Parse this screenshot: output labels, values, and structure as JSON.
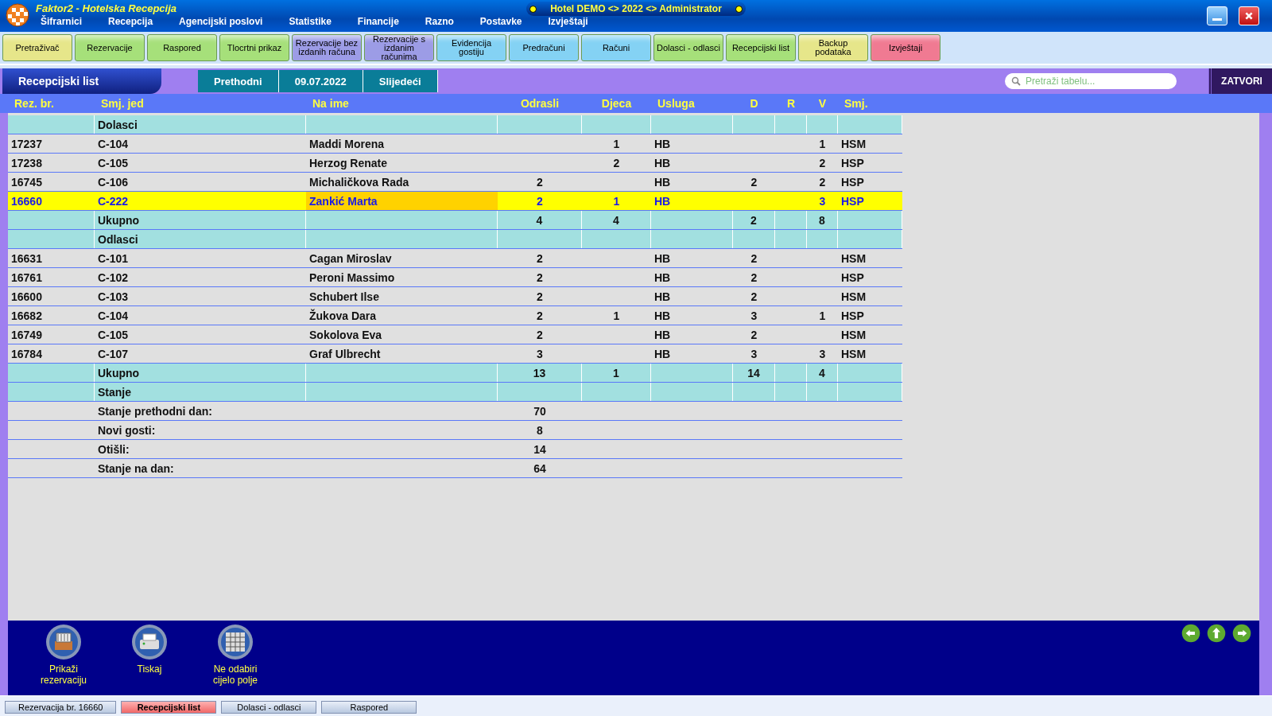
{
  "window": {
    "title": "Faktor2 - Hotelska Recepcija",
    "banner": "Hotel DEMO <> 2022 <> Administrator"
  },
  "menu": [
    "Šifrarnici",
    "Recepcija",
    "Agencijski poslovi",
    "Statistike",
    "Financije",
    "Razno",
    "Postavke",
    "Izvještaji"
  ],
  "toolbar": [
    {
      "label": "Pretraživač",
      "color": "#e6e68a"
    },
    {
      "label": "Rezervacije",
      "color": "#a6e07a"
    },
    {
      "label": "Raspored",
      "color": "#a6e07a"
    },
    {
      "label": "Tlocrtni prikaz",
      "color": "#a6e07a"
    },
    {
      "label": "Rezervacije bez izdanih računa",
      "color": "#9c9ce6"
    },
    {
      "label": "Rezervacije s izdanim računima",
      "color": "#9c9ce6"
    },
    {
      "label": "Evidencija gostiju",
      "color": "#84d2f4"
    },
    {
      "label": "Predračuni",
      "color": "#84d2f4"
    },
    {
      "label": "Računi",
      "color": "#84d2f4"
    },
    {
      "label": "Dolasci - odlasci",
      "color": "#a6e07a"
    },
    {
      "label": "Recepcijski list",
      "color": "#a6e07a"
    },
    {
      "label": "Backup podataka",
      "color": "#e6e68a"
    },
    {
      "label": "Izvještaji",
      "color": "#f07a92"
    }
  ],
  "panel": {
    "title": "Recepcijski list",
    "prev": "Prethodni",
    "date": "09.07.2022",
    "next": "Slijedeći",
    "search": {
      "placeholder": "Pretraži tabelu..."
    },
    "close": "ZATVORI"
  },
  "table": {
    "columns": [
      "Rez. br.",
      "Smj. jed",
      "Na ime",
      "Odrasli",
      "Djeca",
      "Usluga",
      "D",
      "R",
      "V",
      "Smj."
    ],
    "rows": [
      {
        "kind": "group",
        "label": "Dolasci"
      },
      {
        "kind": "guest",
        "selected": false,
        "rez": "17237",
        "unit": "C-104",
        "name": "Maddi Morena",
        "djeca": "1",
        "usluga": "HB",
        "v": "1",
        "smj": "HSM"
      },
      {
        "kind": "guest",
        "selected": false,
        "rez": "17238",
        "unit": "C-105",
        "name": "Herzog Renate",
        "djeca": "2",
        "usluga": "HB",
        "v": "2",
        "smj": "HSP"
      },
      {
        "kind": "guest",
        "selected": false,
        "rez": "16745",
        "unit": "C-106",
        "name": "Michaličkova Rada",
        "odrasli": "2",
        "usluga": "HB",
        "d": "2",
        "v": "2",
        "smj": "HSP"
      },
      {
        "kind": "guest",
        "selected": true,
        "rez": "16660",
        "unit": "C-222",
        "name": "Zankić Marta",
        "odrasli": "2",
        "djeca": "1",
        "usluga": "HB",
        "v": "3",
        "smj": "HSP"
      },
      {
        "kind": "total",
        "label": "Ukupno",
        "odrasli": "4",
        "djeca": "4",
        "d": "2",
        "v": "8"
      },
      {
        "kind": "group",
        "label": "Odlasci"
      },
      {
        "kind": "guest",
        "selected": false,
        "rez": "16631",
        "unit": "C-101",
        "name": "Cagan Miroslav",
        "odrasli": "2",
        "usluga": "HB",
        "d": "2",
        "smj": "HSM"
      },
      {
        "kind": "guest",
        "selected": false,
        "rez": "16761",
        "unit": "C-102",
        "name": "Peroni Massimo",
        "odrasli": "2",
        "usluga": "HB",
        "d": "2",
        "smj": "HSP"
      },
      {
        "kind": "guest",
        "selected": false,
        "rez": "16600",
        "unit": "C-103",
        "name": "Schubert Ilse",
        "odrasli": "2",
        "usluga": "HB",
        "d": "2",
        "smj": "HSM"
      },
      {
        "kind": "guest",
        "selected": false,
        "rez": "16682",
        "unit": "C-104",
        "name": "Žukova Dara",
        "odrasli": "2",
        "djeca": "1",
        "usluga": "HB",
        "d": "3",
        "v": "1",
        "smj": "HSP"
      },
      {
        "kind": "guest",
        "selected": false,
        "rez": "16749",
        "unit": "C-105",
        "name": "Sokolova Eva",
        "odrasli": "2",
        "usluga": "HB",
        "d": "2",
        "smj": "HSM"
      },
      {
        "kind": "guest",
        "selected": false,
        "rez": "16784",
        "unit": "C-107",
        "name": "Graf Ulbrecht",
        "odrasli": "3",
        "usluga": "HB",
        "d": "3",
        "v": "3",
        "smj": "HSM"
      },
      {
        "kind": "total",
        "label": "Ukupno",
        "odrasli": "13",
        "djeca": "1",
        "d": "14",
        "v": "4"
      },
      {
        "kind": "group",
        "label": "Stanje"
      },
      {
        "kind": "stat",
        "label": "Stanje prethodni dan:",
        "odrasli": "70"
      },
      {
        "kind": "stat",
        "label": "Novi gosti:",
        "odrasli": "8"
      },
      {
        "kind": "stat",
        "label": "Otišli:",
        "odrasli": "14"
      },
      {
        "kind": "stat",
        "label": "Stanje na dan:",
        "odrasli": "64"
      }
    ]
  },
  "actions": [
    {
      "kind": "drawer",
      "label": "Prikaži rezervaciju"
    },
    {
      "kind": "printer",
      "label": "Tiskaj"
    },
    {
      "kind": "grid",
      "label": "Ne odabiri cijelo polje"
    }
  ],
  "status_tabs": [
    {
      "label": "Rezervacija br. 16660",
      "selected": false
    },
    {
      "label": "Recepcijski list",
      "selected": true
    },
    {
      "label": "Dolasci - odlasci",
      "selected": false
    },
    {
      "label": "Raspored",
      "selected": false
    }
  ]
}
